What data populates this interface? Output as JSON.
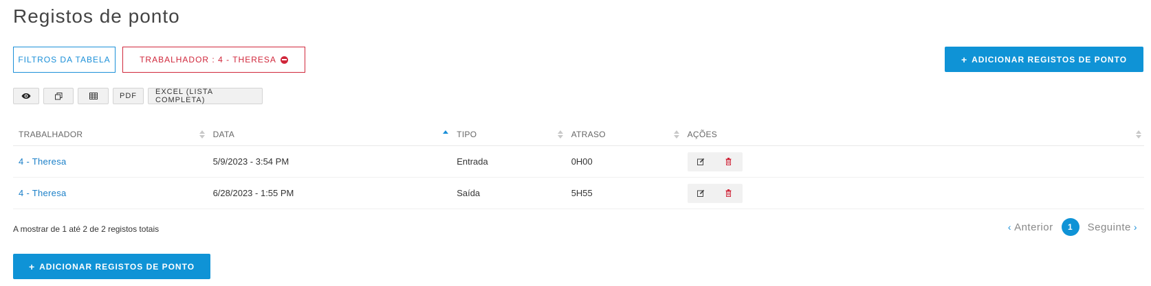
{
  "page": {
    "title": "Registos de ponto"
  },
  "filters": {
    "table_filters_label": "FILTROS DA TABELA",
    "active_filter_label": "TRABALHADOR : 4 - THERESA"
  },
  "actions": {
    "add_label": "ADICIONAR REGISTOS DE PONTO"
  },
  "toolbar": {
    "eye_icon": "eye-icon",
    "copy_icon": "copy-icon",
    "csv_icon": "table-icon",
    "pdf_label": "PDF",
    "excel_label": "EXCEL (LISTA COMPLETA)"
  },
  "table": {
    "columns": [
      "TRABALHADOR",
      "DATA",
      "TIPO",
      "ATRASO",
      "AÇÕES"
    ],
    "sorted_column": "DATA",
    "rows": [
      {
        "worker": "4 - Theresa",
        "date": "5/9/2023 - 3:54 PM",
        "type": "Entrada",
        "delay": "0H00"
      },
      {
        "worker": "4 - Theresa",
        "date": "6/28/2023 - 1:55 PM",
        "type": "Saída",
        "delay": "5H55"
      }
    ]
  },
  "footer": {
    "info": "A mostrar de 1 até 2 de 2 registos totais",
    "prev_label": "Anterior",
    "next_label": "Seguinte",
    "current_page": "1"
  },
  "colors": {
    "primary": "#0f93d6",
    "danger": "#d0263a",
    "link": "#1a7fc8"
  }
}
